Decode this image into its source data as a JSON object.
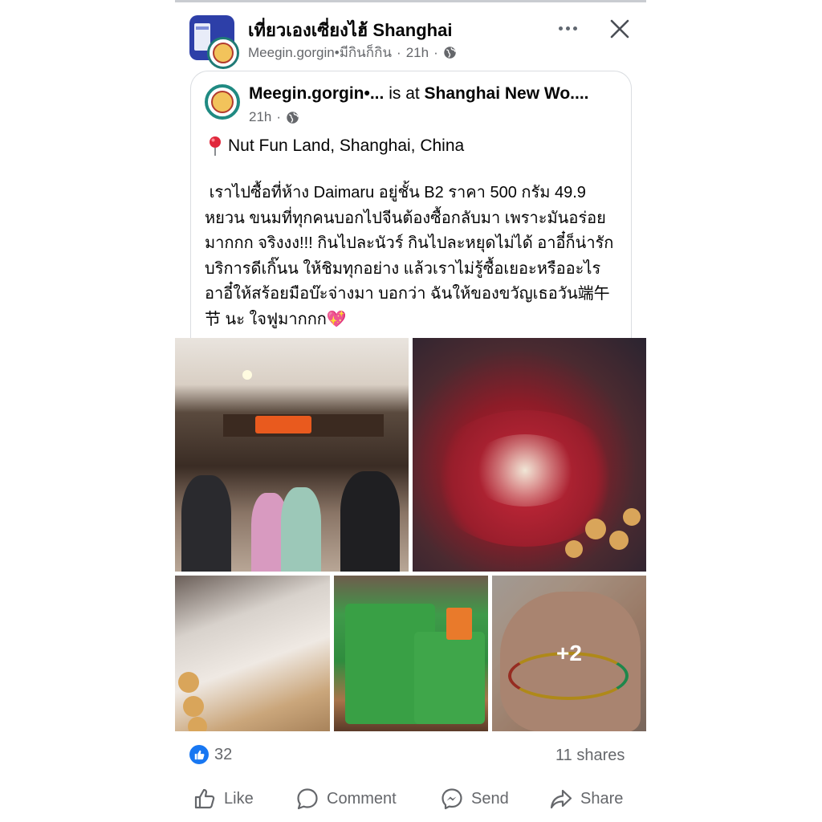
{
  "group": {
    "name": "เที่ยวเองเซี่ยงไฮ้ Shanghai",
    "author": "Meegin.gorgin•มีกินก็กิน",
    "time": "21h"
  },
  "shared_post": {
    "author": "Meegin.gorgin•...",
    "is_at": " is at ",
    "place": "Shanghai New Wo....",
    "time": "21h",
    "location": "Nut Fun Land, Shanghai, China",
    "body": " เราไปซื้อที่ห้าง Daimaru อยู่ชั้น B2 ราคา 500 กรัม 49.9 หยวน ขนมที่ทุกคนบอกไปจีนต้องซื้อกลับมา เพราะมันอร่อยมากกก จริงงง!!! กินไปละนัวร์ กินไปละหยุดไม่ได้ อาอี๋ก็น่ารัก บริการดีเกิ๊นน ให้ชิมทุกอย่าง แล้วเราไม่รู้ซื้อเยอะหรืออะไร อาอี๋ให้สร้อยมือบ๊ะจ่างมา บอกว่า ฉันให้ของขวัญเธอวัน端午节 นะ ใจฟูมากกก💖"
  },
  "photos": {
    "more_count": "+2"
  },
  "reactions": {
    "count": "32",
    "shares": "11 shares"
  },
  "actions": {
    "like": "Like",
    "comment": "Comment",
    "send": "Send",
    "share": "Share"
  },
  "icons": [
    "globe-icon",
    "more-icon",
    "close-icon",
    "pin-icon",
    "like-icon",
    "comment-icon",
    "messenger-icon",
    "share-icon"
  ],
  "colors": {
    "accent": "#1877f2",
    "meta": "#65676b"
  }
}
